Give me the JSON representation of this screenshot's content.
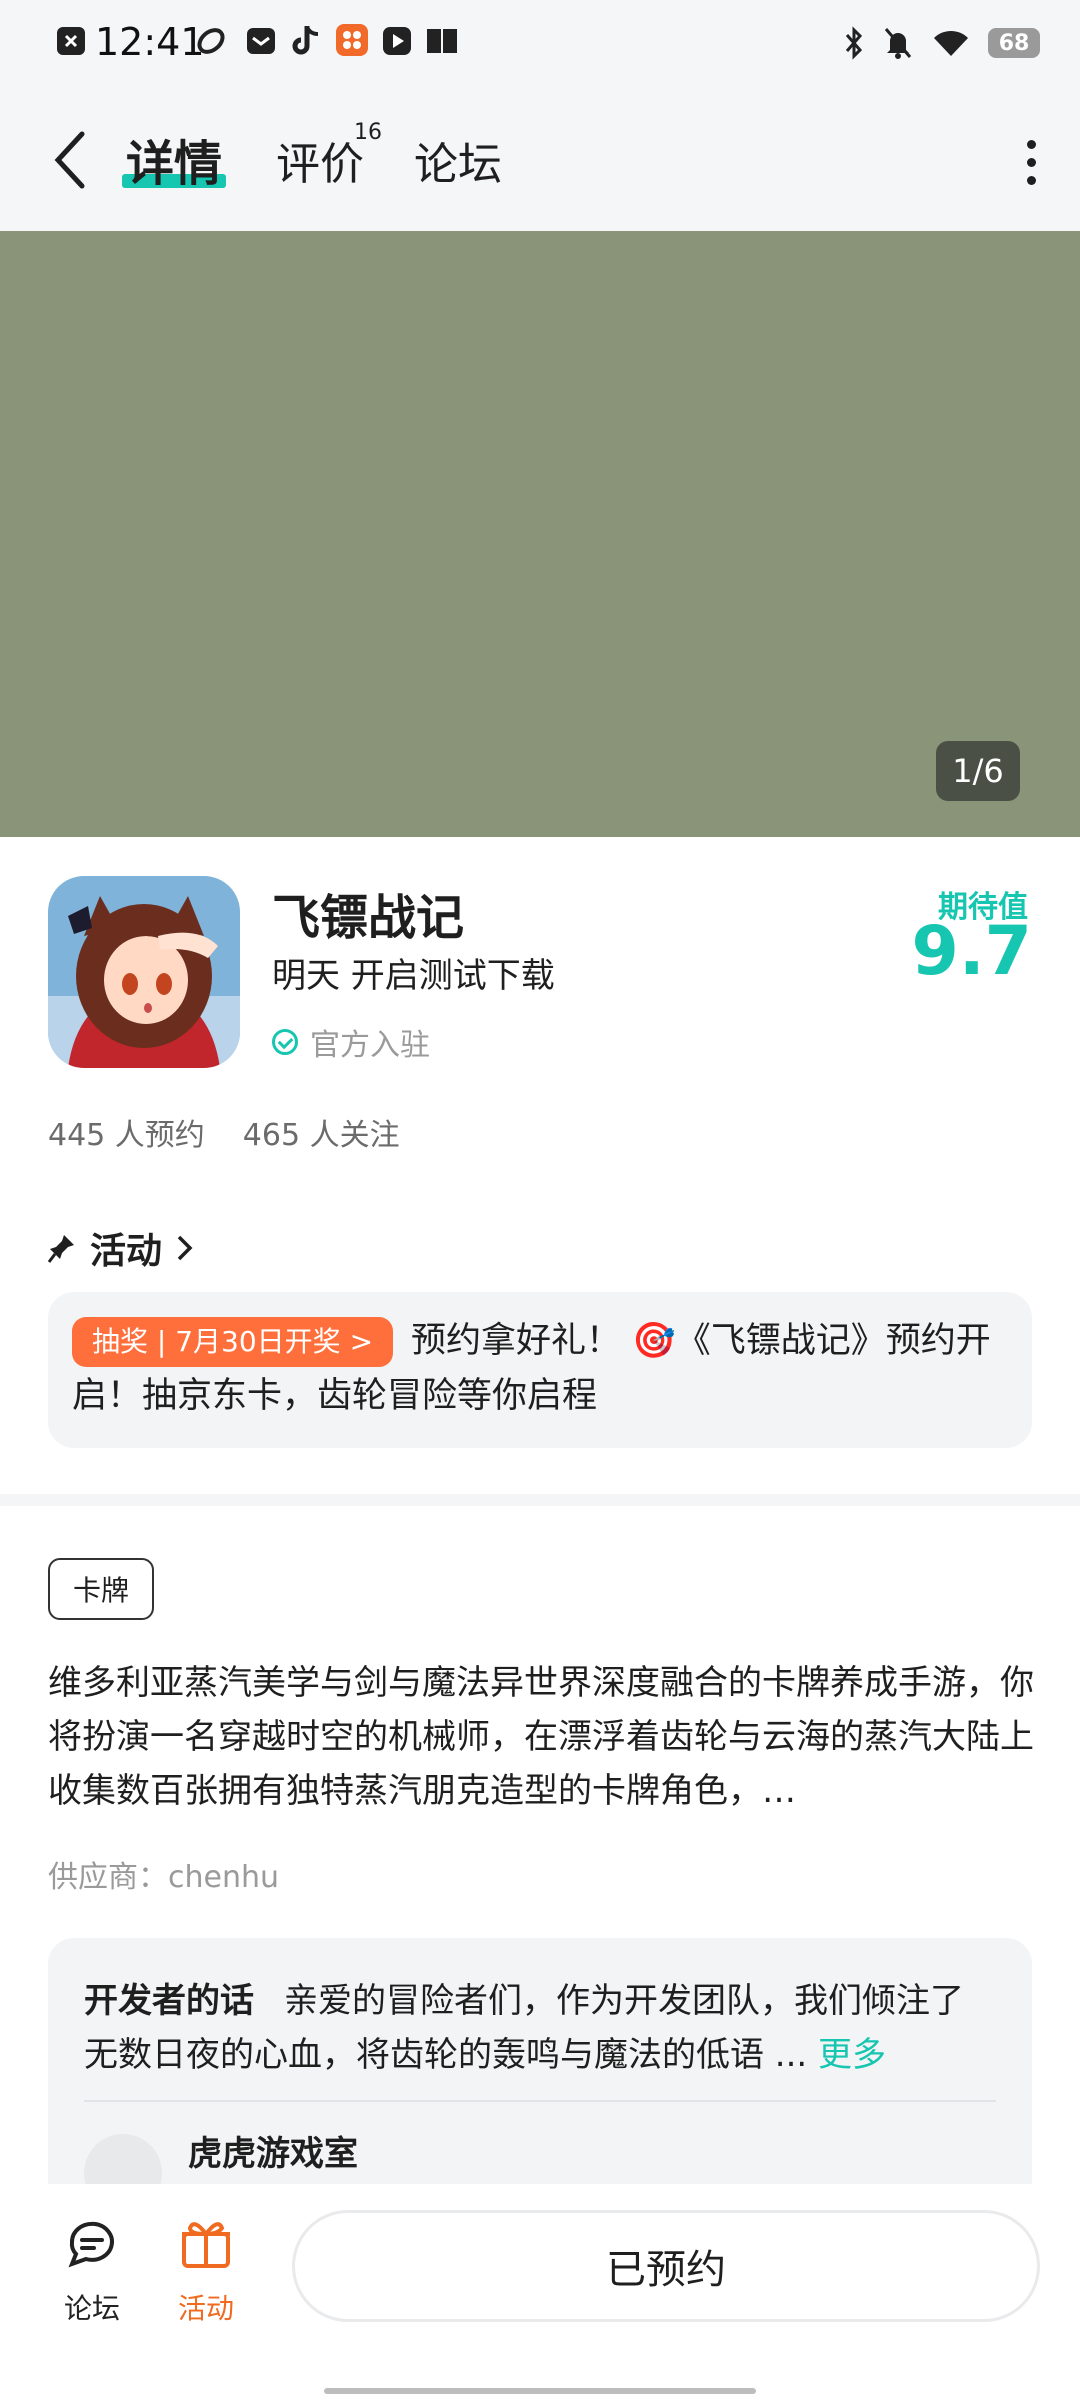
{
  "status_bar": {
    "time": "12:41",
    "battery": "68",
    "icons": [
      "close-notif-icon",
      "app-icon-1",
      "mail-icon",
      "tiktok-icon",
      "orange-app-icon",
      "play-icon",
      "book-icon",
      "bluetooth-icon",
      "mute-icon",
      "wifi-icon"
    ]
  },
  "header": {
    "tabs": [
      {
        "label": "详情",
        "active": true
      },
      {
        "label": "评价",
        "badge": "16"
      },
      {
        "label": "论坛"
      }
    ]
  },
  "banner": {
    "counter": "1/6",
    "color": "#8a9478"
  },
  "app": {
    "name": "飞镖战记",
    "release": "明天 开启测试下载",
    "official": "官方入驻",
    "expect_label": "期待值",
    "expect_value": "9.7",
    "reservations": "445 人预约",
    "followers": "465 人关注"
  },
  "activity": {
    "title": "活动",
    "lottery_label": "抽奖 | 7月30日开奖 >",
    "text": "预约拿好礼！ 🎯《飞镖战记》预约开启！抽京东卡，齿轮冒险等你启程"
  },
  "tag": "卡牌",
  "description": "维多利亚蒸汽美学与剑与魔法异世界深度融合的卡牌养成手游，你将扮演一名穿越时空的机械师，在漂浮着齿轮与云海的蒸汽大陆上收集数百张拥有独特蒸汽朋克造型的卡牌角色，…",
  "supplier": "供应商：chenhu",
  "developer": {
    "label": "开发者的话",
    "text": "亲爱的冒险者们，作为开发团队，我们倾注了无数日夜的心血，将齿轮的轰鸣与魔法的低语 ...",
    "more": "更多",
    "studio": "虎虎游戏室"
  },
  "bottom": {
    "forum": "论坛",
    "activity": "活动",
    "reserved": "已预约"
  },
  "colors": {
    "accent": "#17c6b0",
    "orange": "#ff6f3c"
  }
}
